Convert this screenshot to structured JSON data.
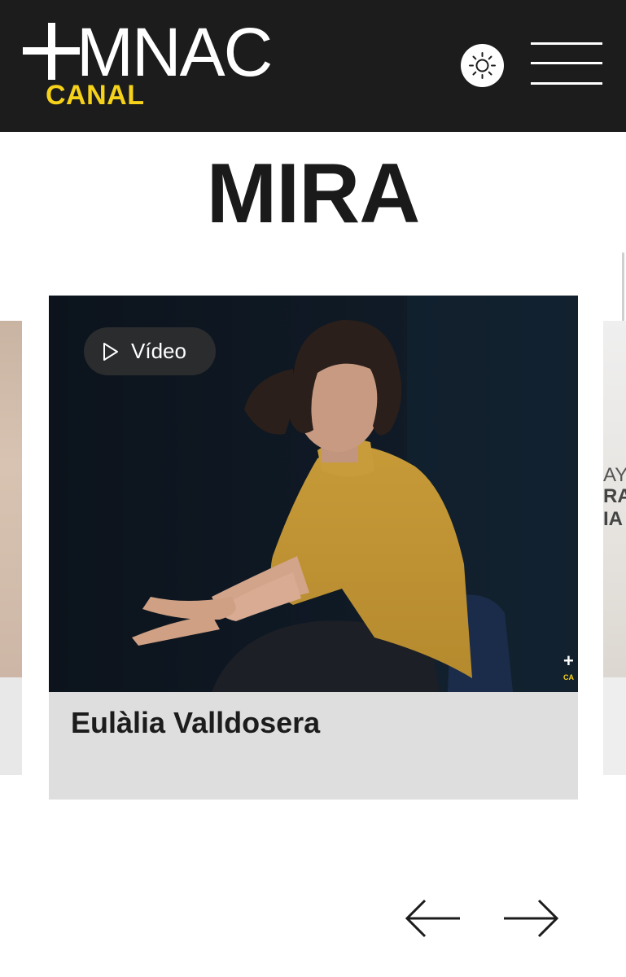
{
  "header": {
    "logo": {
      "plus_icon": "plus-icon",
      "brand": "MNAC",
      "subtitle": "CANAL",
      "subtitle_color": "#f6d21a"
    },
    "theme_toggle_icon": "sun-icon",
    "menu_icon": "hamburger-menu-icon"
  },
  "page": {
    "title": "MIRA"
  },
  "carousel": {
    "active_card": {
      "badge": {
        "icon": "play-icon",
        "label": "Vídeo"
      },
      "title": "Eulàlia Valldosera",
      "image": "woman-in-mustard-sweater-speaking-photo"
    },
    "peek_right_text": [
      "AY",
      "RA",
      "IA"
    ],
    "watermark": {
      "plus": "+",
      "sub": "CA"
    },
    "prev_icon": "arrow-left-icon",
    "next_icon": "arrow-right-icon"
  },
  "colors": {
    "header_bg": "#1c1c1c",
    "accent": "#f6d21a",
    "caption_bg": "#dedede"
  }
}
